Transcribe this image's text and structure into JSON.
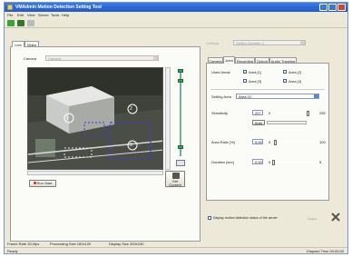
{
  "window": {
    "title": "VMAdmin Motion Detection Setting Tool"
  },
  "menu": {
    "items": [
      "File",
      "Edit",
      "View",
      "Server",
      "Tools",
      "Help"
    ]
  },
  "toolbar": {
    "icons": [
      "open-icon",
      "save-icon",
      "settings-icon"
    ]
  },
  "left_tabs": {
    "tabs": [
      "Live",
      "Video"
    ],
    "active": "Live"
  },
  "camera": {
    "label": "Camera",
    "value": "Camera"
  },
  "video": {
    "zone_labels": [
      "1",
      "2",
      "3"
    ]
  },
  "left_buttons": {
    "run_start": "Run Start",
    "get_current": "Get Current"
  },
  "right_top": {
    "settings_label": "Settings",
    "settings_value": "Setting Number 1"
  },
  "right_tabs": {
    "tabs": [
      "Camera",
      "Area",
      "Recording",
      "Output",
      "Audio Tracking"
    ],
    "active": "Area"
  },
  "area_panel": {
    "used_areas_label": "Used Areas",
    "areas": [
      {
        "label": "Area [1]",
        "checked": true
      },
      {
        "label": "Area [2]",
        "checked": false
      },
      {
        "label": "Area [3]",
        "checked": false
      },
      {
        "label": "Area [4]",
        "checked": false
      }
    ],
    "setting_area_label": "Setting Area",
    "setting_area_value": "Area [1]",
    "sensitivity_label": "Sensitivity",
    "sensitivity_value": "207",
    "sensitivity_min": "0",
    "sensitivity_max": "255",
    "sensitivity_level": 0.81,
    "auto_label": "Auto",
    "area_ratio_label": "Area Ratio [%]",
    "area_ratio_value": "5.00",
    "area_ratio_min": "0",
    "area_ratio_max": "100",
    "area_ratio_level": 0.05,
    "duration_label": "Duration [sec]",
    "duration_value": "0.00",
    "duration_min": "0",
    "duration_max": "5",
    "duration_level": 0.0
  },
  "bottom_right": {
    "checkbox_label": "Display motion detection status of the server",
    "apply_label": "Apply"
  },
  "info_bar": {
    "frame_rate": "Frame Rate  30.0fps",
    "processing_size": "Processing Size  160x120",
    "display_size": "Display Size  320x240"
  },
  "status_bar": {
    "left": "Ready",
    "right": "Elapsed Time 00:00:00"
  },
  "colors": {
    "titlebar": "#2a63d6",
    "accent_green": "#3aa33a",
    "run_start_red": "#c0301f",
    "selection_blue": "#5b82d6"
  }
}
